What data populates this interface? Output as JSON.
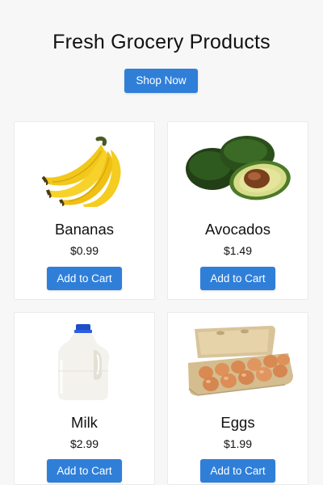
{
  "page": {
    "title": "Fresh Grocery Products",
    "shop_button_label": "Shop Now",
    "accent_color": "#2f7fd9"
  },
  "products": [
    {
      "name": "Bananas",
      "price": "$0.99",
      "button_label": "Add to Cart",
      "icon": "banana-image"
    },
    {
      "name": "Avocados",
      "price": "$1.49",
      "button_label": "Add to Cart",
      "icon": "avocado-image"
    },
    {
      "name": "Milk",
      "price": "$2.99",
      "button_label": "Add to Cart",
      "icon": "milk-jug-image"
    },
    {
      "name": "Eggs",
      "price": "$1.99",
      "button_label": "Add to Cart",
      "icon": "egg-carton-image"
    }
  ]
}
